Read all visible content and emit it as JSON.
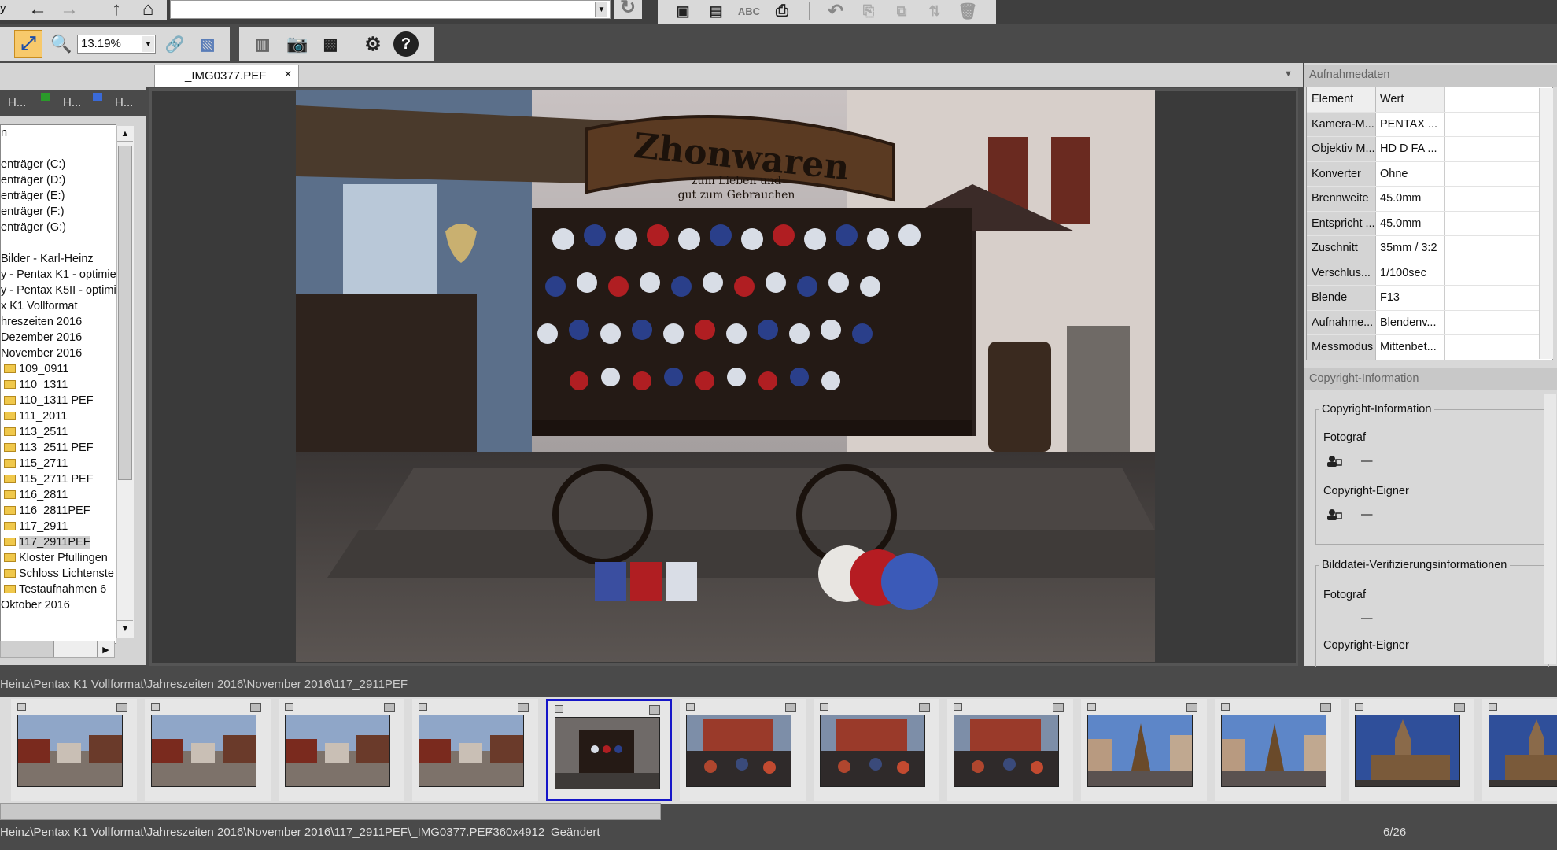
{
  "toolbar": {
    "address_value": "",
    "zoom_value": "13.19%",
    "left_clip_text": "y"
  },
  "left_panel": {
    "tabs": [
      "H...",
      "H...",
      "H..."
    ],
    "tree": [
      {
        "label": "n",
        "folder": false
      },
      {
        "label": "",
        "folder": false
      },
      {
        "label": "enträger (C:)",
        "folder": false
      },
      {
        "label": "enträger (D:)",
        "folder": false
      },
      {
        "label": "enträger (E:)",
        "folder": false
      },
      {
        "label": "enträger (F:)",
        "folder": false
      },
      {
        "label": "enträger (G:)",
        "folder": false
      },
      {
        "label": "",
        "folder": false
      },
      {
        "label": "Bilder -  Karl-Heinz",
        "folder": false
      },
      {
        "label": "y - Pentax K1 - optimier",
        "folder": false
      },
      {
        "label": "y - Pentax K5II - optimie",
        "folder": false
      },
      {
        "label": "x K1 Vollformat",
        "folder": false
      },
      {
        "label": "hreszeiten 2016",
        "folder": false
      },
      {
        "label": " Dezember 2016",
        "folder": false
      },
      {
        "label": " November 2016",
        "folder": false
      },
      {
        "label": "109_0911",
        "folder": true
      },
      {
        "label": "110_1311",
        "folder": true
      },
      {
        "label": "110_1311 PEF",
        "folder": true
      },
      {
        "label": "111_2011",
        "folder": true
      },
      {
        "label": "113_2511",
        "folder": true
      },
      {
        "label": "113_2511 PEF",
        "folder": true
      },
      {
        "label": "115_2711",
        "folder": true
      },
      {
        "label": "115_2711 PEF",
        "folder": true
      },
      {
        "label": "116_2811",
        "folder": true
      },
      {
        "label": "116_2811PEF",
        "folder": true
      },
      {
        "label": "117_2911",
        "folder": true
      },
      {
        "label": "117_2911PEF",
        "folder": true,
        "selected": true
      },
      {
        "label": "Kloster Pfullingen",
        "folder": true
      },
      {
        "label": "Schloss Lichtenste",
        "folder": true
      },
      {
        "label": "Testaufnahmen  6",
        "folder": true
      },
      {
        "label": " Oktober 2016",
        "folder": false
      }
    ]
  },
  "viewer": {
    "tab_title": "_IMG0377.PEF",
    "close_glyph": "×",
    "photo_sign": "Zhonwaren",
    "photo_sign_sub1": "zum Lieben und",
    "photo_sign_sub2": "gut zum Gebrauchen"
  },
  "right_panel": {
    "meta_title": "Aufnahmedaten",
    "meta_headers": {
      "element": "Element",
      "value": "Wert"
    },
    "meta_rows": [
      {
        "element": "Kamera-M...",
        "value": "PENTAX ..."
      },
      {
        "element": "Objektiv M...",
        "value": "HD D FA ..."
      },
      {
        "element": "Konverter",
        "value": "Ohne"
      },
      {
        "element": "Brennweite",
        "value": "45.0mm"
      },
      {
        "element": "Entspricht ...",
        "value": "45.0mm"
      },
      {
        "element": "Zuschnitt",
        "value": "35mm / 3:2"
      },
      {
        "element": "Verschlus...",
        "value": "1/100sec"
      },
      {
        "element": "Blende",
        "value": "F13"
      },
      {
        "element": "Aufnahme...",
        "value": "Blendenv..."
      },
      {
        "element": "Messmodus",
        "value": "Mittenbet..."
      }
    ],
    "copyright_title": "Copyright-Information",
    "copyright_group": "Copyright-Information",
    "fotograf_label": "Fotograf",
    "fotograf_value": "—",
    "owner_label": "Copyright-Eigner",
    "owner_value": "—",
    "verify_group": "Bilddatei-Verifizierungsinformationen",
    "verify_fotograf_label": "Fotograf",
    "verify_fotograf_value": "—",
    "verify_owner_label": "Copyright-Eigner"
  },
  "path_bar": "Heinz\\Pentax K1 Vollformat\\Jahreszeiten 2016\\November 2016\\117_2911PEF",
  "filmstrip": {
    "thumbs": [
      {
        "scene": "market"
      },
      {
        "scene": "market"
      },
      {
        "scene": "market"
      },
      {
        "scene": "market"
      },
      {
        "scene": "cart",
        "selected": true
      },
      {
        "scene": "crowd"
      },
      {
        "scene": "crowd"
      },
      {
        "scene": "crowd"
      },
      {
        "scene": "pyramid"
      },
      {
        "scene": "pyramid"
      },
      {
        "scene": "church"
      },
      {
        "scene": "church"
      }
    ]
  },
  "status": {
    "path": "Heinz\\Pentax K1 Vollformat\\Jahreszeiten 2016\\November 2016\\117_2911PEF\\_IMG0377.PEF",
    "dimensions": "7360x4912",
    "state": "Geändert",
    "counter": "6/26"
  },
  "colors": {
    "accent": "#1515c8",
    "toolbar_bg": "#4a4a4a",
    "panel_bg": "#d8d8d8"
  }
}
